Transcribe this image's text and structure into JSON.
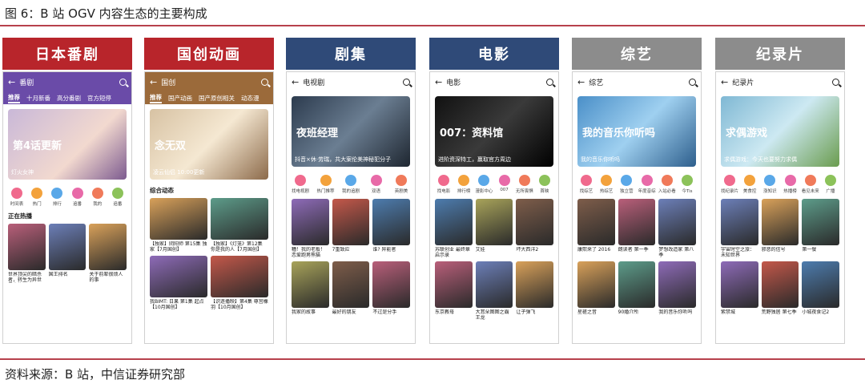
{
  "figure": {
    "title": "图 6：B 站 OGV 内容生态的主要构成",
    "source": "资料来源：B 站，中信证券研究部"
  },
  "columns": [
    {
      "banner": "日本番剧",
      "banner_color": "#b8252b",
      "bar_color": "#6a4ba8",
      "page_title": "番剧",
      "tabs": [
        "推荐",
        "十月新番",
        "高分番剧",
        "官方短停"
      ],
      "hero_text": "第4话更新",
      "hero_caption": "灯火女神",
      "icons": [
        "时间表",
        "热门",
        "排行",
        "追番",
        "我的",
        "追番"
      ],
      "section": "正在热播",
      "cards": [
        {
          "title": "世界顶尖的暗杀者，转生为异世界贵族"
        },
        {
          "title": "国王排名"
        },
        {
          "title": "关于前辈很烦人的事"
        }
      ]
    },
    {
      "banner": "国创动画",
      "banner_color": "#b8252b",
      "bar_color": "#9b6a3a",
      "page_title": "国创",
      "tabs": [
        "推荐",
        "国产动画",
        "国产原创相关",
        "动态漫"
      ],
      "hero_text": "念无双",
      "hero_caption": "凌云仙侣 10:00更新",
      "icons": [],
      "section": "综合动态",
      "cards": [
        {
          "title": "【独家】阴阳师 第15集 独家【7月国创】"
        },
        {
          "title": "【独家】《灯笼》第12集 你是我的人【7月国创】"
        },
        {
          "title": "我BIMT: 日果 第1集 起点【10月国创】"
        },
        {
          "title": "【识逐播映】第4集 尊宫橡羽【10月国创】"
        }
      ]
    },
    {
      "banner": "剧集",
      "banner_color": "#2f4a78",
      "bar_color": "#ffffff",
      "page_title": "电视剧",
      "tabs": [],
      "hero_text": "夜班经理",
      "hero_caption": "抖音×休·劳瑞，共大案伦美神秘犯分子",
      "icons": [
        "找电视剧",
        "热门推荐",
        "我的追剧",
        "双语",
        "英剧美"
      ],
      "section": "",
      "cards": [
        {
          "title": "糟！我的老板！恋爱跑男熊猫"
        },
        {
          "title": "7重致应"
        },
        {
          "title": "谁? 异能者"
        },
        {
          "title": "我家的故事"
        },
        {
          "title": "最好的朋友"
        },
        {
          "title": "不过是分手"
        }
      ]
    },
    {
      "banner": "电影",
      "banner_color": "#2f4a78",
      "bar_color": "#ffffff",
      "page_title": "电影",
      "tabs": [],
      "hero_text": "007：资料馆",
      "hero_caption": "进阶资深特工，赢取官方周边",
      "icons": [
        "找电影",
        "排行榜",
        "漫影中心",
        "007",
        "无所畏惧",
        "首映"
      ],
      "section": "",
      "cards": [
        {
          "title": "苏联创业 最终章启示录"
        },
        {
          "title": "艾娃"
        },
        {
          "title": "坏大西洋2"
        },
        {
          "title": "东京教母"
        },
        {
          "title": "大耳朵图图之霸王龙"
        },
        {
          "title": "让子弹飞"
        }
      ]
    },
    {
      "banner": "综艺",
      "banner_color": "#8c8c8c",
      "bar_color": "#ffffff",
      "page_title": "综艺",
      "tabs": [],
      "hero_text": "我的音乐你听吗",
      "hero_caption": "我的音乐你听吗",
      "icons": [
        "找综艺",
        "热综艺",
        "独立营",
        "年度音综",
        "入站必看",
        "今Tis"
      ],
      "section": "",
      "cards": [
        {
          "title": "康熙来了 2016"
        },
        {
          "title": "朗读者 第一季"
        },
        {
          "title": "梦想改造家 第八季"
        },
        {
          "title": "星槎之音"
        },
        {
          "title": "90婚介所"
        },
        {
          "title": "我的音乐你听吗"
        }
      ]
    },
    {
      "banner": "纪录片",
      "banner_color": "#8c8c8c",
      "bar_color": "#ffffff",
      "page_title": "纪录片",
      "tabs": [],
      "hero_text": "求偶游戏",
      "hero_caption": "求偶游戏：今天也要努力求偶",
      "icons": [
        "找纪录片",
        "美食控",
        "涨知识",
        "热播榜",
        "看见未来",
        "广播"
      ],
      "section": "",
      "cards": [
        {
          "title": "宇宙时空之旅：未知世界"
        },
        {
          "title": "邪恶的信号"
        },
        {
          "title": "第一餐"
        },
        {
          "title": "紫禁城"
        },
        {
          "title": "荒野独居 第七季"
        },
        {
          "title": "小城夜食记2"
        }
      ]
    }
  ]
}
